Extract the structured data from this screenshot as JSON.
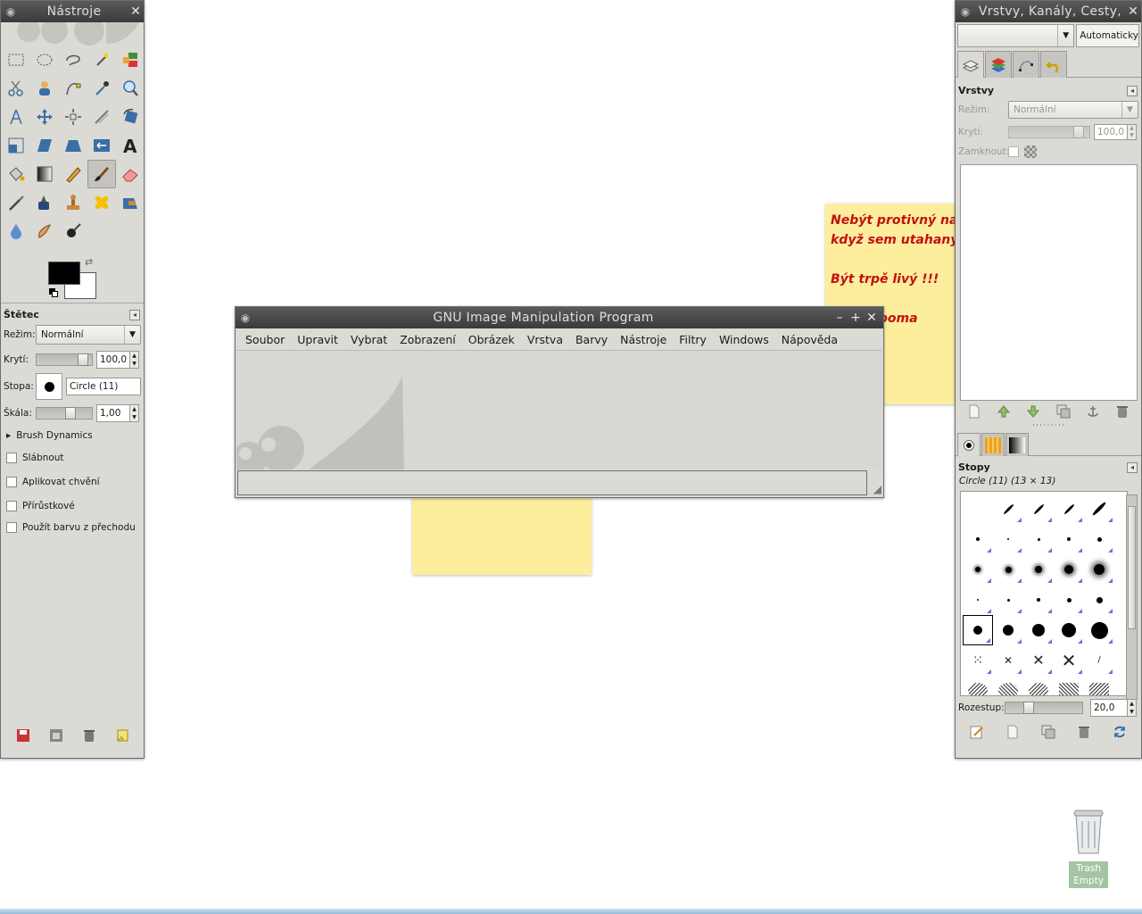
{
  "toolbox": {
    "title": "Nástroje",
    "tool_options_title": "Štětec",
    "mode_label": "Režim:",
    "mode_value": "Normální",
    "opacity_label": "Krytí:",
    "opacity_value": "100,0",
    "brush_label": "Stopa:",
    "brush_value": "Circle (11)",
    "scale_label": "Škála:",
    "scale_value": "1,00",
    "brush_dynamics": "Brush Dynamics",
    "options": [
      "Slábnout",
      "Aplikovat chvění",
      "Přírůstkové",
      "Použít barvu z přechodu"
    ],
    "fg_color": "#000000",
    "bg_color": "#ffffff"
  },
  "main_window": {
    "title": "GNU Image Manipulation Program",
    "menu": [
      "Soubor",
      "Upravit",
      "Vybrat",
      "Zobrazení",
      "Obrázek",
      "Vrstva",
      "Barvy",
      "Nástroje",
      "Filtry",
      "Windows",
      "Nápověda"
    ]
  },
  "sticky_note": {
    "lines": [
      "Nebýt protivný na o",
      "když  sem utahaný",
      "",
      "Být trpě livý !!!",
      "",
      "ch být poma"
    ],
    "color": "#c21010"
  },
  "dock": {
    "title": "Vrstvy, Kanály, Cesty,",
    "auto_button": "Automaticky",
    "layers_title": "Vrstvy",
    "mode_label": "Režim:",
    "mode_value": "Normální",
    "opacity_label": "Krytí:",
    "opacity_value": "100,0",
    "lock_label": "Zamknout:",
    "brushes_title": "Stopy",
    "brush_info": "Circle (11) (13 × 13)",
    "spacing_label": "Rozestup:",
    "spacing_value": "20,0"
  },
  "desktop": {
    "trash_label": "Trash Empty"
  }
}
